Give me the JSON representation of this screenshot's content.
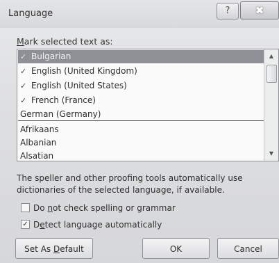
{
  "dialog": {
    "title": "Language",
    "help_label": "?",
    "close_label": "✖"
  },
  "mark_label_prefix": "M",
  "mark_label_rest": "ark selected text as:",
  "list": {
    "items": [
      {
        "label": "Bulgarian",
        "check": "✓",
        "selected": true
      },
      {
        "label": "English (United Kingdom)",
        "check": "✓",
        "selected": false
      },
      {
        "label": "English (United States)",
        "check": "✓",
        "selected": false
      },
      {
        "label": "French (France)",
        "check": "✓",
        "selected": false
      },
      {
        "label": "German (Germany)",
        "check": "",
        "selected": false
      },
      {
        "label": "Afrikaans",
        "check": "",
        "selected": false
      },
      {
        "label": "Albanian",
        "check": "",
        "selected": false
      },
      {
        "label": "Alsatian",
        "check": "",
        "selected": false
      }
    ],
    "scroll_up": "▲",
    "scroll_down": "▼"
  },
  "info_text": "The speller and other proofing tools automatically use dictionaries of the selected language, if available.",
  "options": {
    "no_check": {
      "pre": "Do ",
      "key": "n",
      "post": "ot check spelling or grammar",
      "checked": false,
      "mark": ""
    },
    "detect": {
      "pre": "D",
      "key": "e",
      "post": "tect language automatically",
      "checked": true,
      "mark": "✓"
    }
  },
  "buttons": {
    "default_pre": "Set As ",
    "default_key": "D",
    "default_post": "efault",
    "ok": "OK",
    "cancel": "Cancel"
  }
}
